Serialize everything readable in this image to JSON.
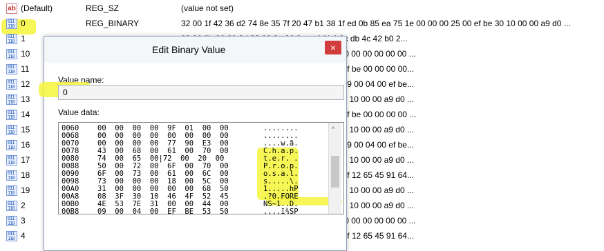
{
  "registry": {
    "rows": [
      {
        "icon": "ab",
        "name": "(Default)",
        "type": "REG_SZ",
        "data": "(value not set)"
      },
      {
        "icon": "bin",
        "name": "0",
        "type": "REG_BINARY",
        "data": "32 00 1f 42 36 d2 74 8e 35 7f 20 47 b1 38 1f ed 0b 85 ea 75 1e 00 00 00 25 00 ef be 30 10 00 00 a9 d0 ..."
      },
      {
        "icon": "bin",
        "name": "1",
        "type": "",
        "data": "08 00 2b 30 30 9d 32 00 2e 80 3a cc bf b4 2c db 4c 42 b0 2..."
      },
      {
        "icon": "bin",
        "name": "10",
        "type": "",
        "data": "08 00 2b 30 30 9d 19 00 2f 44 3a 5c 00 00 00 00 00 00 00 00 ..."
      },
      {
        "icon": "bin",
        "name": "11",
        "type": "",
        "data": "64 66 2e 4a 50 47 00 00 3e 00 09 00 04 00 ef be 00 00 00 00..."
      },
      {
        "icon": "bin",
        "name": "12",
        "type": "",
        "data": "43 61 70 74 75 72 65 2e 4a 50 47 00 48 00 09 00 04 00 ef be..."
      },
      {
        "icon": "bin",
        "name": "13",
        "type": "",
        "data": "1f ed 0b 85 ea 75 1e 00 00 00 25 00 ef be 30 10 00 00 a9 d0 ..."
      },
      {
        "icon": "bin",
        "name": "14",
        "type": "",
        "data": "31 32 2e 4a 50 47 00 00 3e 00 09 00 04 00 ef be 00 00 00 00 ..."
      },
      {
        "icon": "bin",
        "name": "15",
        "type": "",
        "data": "1f ed 0b 85 ea 75 1e 00 00 00 25 00 ef be 30 10 00 00 a9 d0 ..."
      },
      {
        "icon": "bin",
        "name": "16",
        "type": "",
        "data": "49 6d 61 67 65 20 31 2e 70 6e 67 00 48 00 09 00 04 00 ef be..."
      },
      {
        "icon": "bin",
        "name": "17",
        "type": "",
        "data": "1f ed 0b 85 ea 75 1e 00 00 00 25 00 ef be 30 10 00 00 a9 d0 ..."
      },
      {
        "icon": "bin",
        "name": "18",
        "type": "",
        "data": "08 00 2b 30 30 9d 14 00 2e 80 90 e2 4d 37 3f 12 65 45 91 64..."
      },
      {
        "icon": "bin",
        "name": "19",
        "type": "",
        "data": "1f ed 0b 85 ea 75 1e 00 00 00 25 00 ef be 30 10 00 00 a9 d0 ..."
      },
      {
        "icon": "bin",
        "name": "2",
        "type": "",
        "data": "1f ed 0b 85 ea 75 1e 00 00 00 25 00 ef be 30 10 00 00 a9 d0 ..."
      },
      {
        "icon": "bin",
        "name": "3",
        "type": "",
        "data": "08 00 2b 30 30 9d 19 00 2f 44 3a 5c 00 00 00 00 00 00 00 00 ..."
      },
      {
        "icon": "bin",
        "name": "4",
        "type": "",
        "data": "08 00 2b 30 30 9d 14 00 2e 80 90 e2 4d 37 3f 12 65 45 91 64..."
      }
    ]
  },
  "dialog": {
    "title": "Edit Binary Value",
    "close_glyph": "×",
    "value_name_label": "Value name:",
    "value_name": "0",
    "value_data_label": "Value data:",
    "scroll_up_glyph": "^",
    "hex_rows": [
      {
        "addr": "0060",
        "bytes": "00  00  00  00  9F  01  00  00",
        "ascii": "........"
      },
      {
        "addr": "0068",
        "bytes": "00  00  00  00  00  00  00  00",
        "ascii": "........"
      },
      {
        "addr": "0070",
        "bytes": "00  00  00  00  77  90  E3  00",
        "ascii": "....w.ã."
      },
      {
        "addr": "0078",
        "bytes": "43  00  68  00  61  00  70  00",
        "ascii": "C.h.a.p."
      },
      {
        "addr": "0080",
        "bytes": "74  00  65  00|72  00  20  00",
        "ascii": "t.e.r. ."
      },
      {
        "addr": "0088",
        "bytes": "50  00  72  00  6F  00  70  00",
        "ascii": "P.r.o.p."
      },
      {
        "addr": "0090",
        "bytes": "6F  00  73  00  61  00  6C  00",
        "ascii": "o.s.a.l."
      },
      {
        "addr": "0098",
        "bytes": "73  00  00  00  18  00  5C  00",
        "ascii": "s.....\\."
      },
      {
        "addr": "00A0",
        "bytes": "31  00  00  00  00  00  68  50",
        "ascii": "1.....hP"
      },
      {
        "addr": "00A8",
        "bytes": "08  3F  30  10  46  4F  52  45",
        "ascii": ".?0.FORE"
      },
      {
        "addr": "00B0",
        "bytes": "4E  53  7E  31  00  00  44  00",
        "ascii": "NS~1..D."
      },
      {
        "addr": "00B8",
        "bytes": "09  00  04  00  EF  BE  53  50",
        "ascii": "....ï¾SP"
      }
    ]
  },
  "colors": {
    "highlight": "#f5f53a",
    "close_button": "#d13c3c"
  }
}
